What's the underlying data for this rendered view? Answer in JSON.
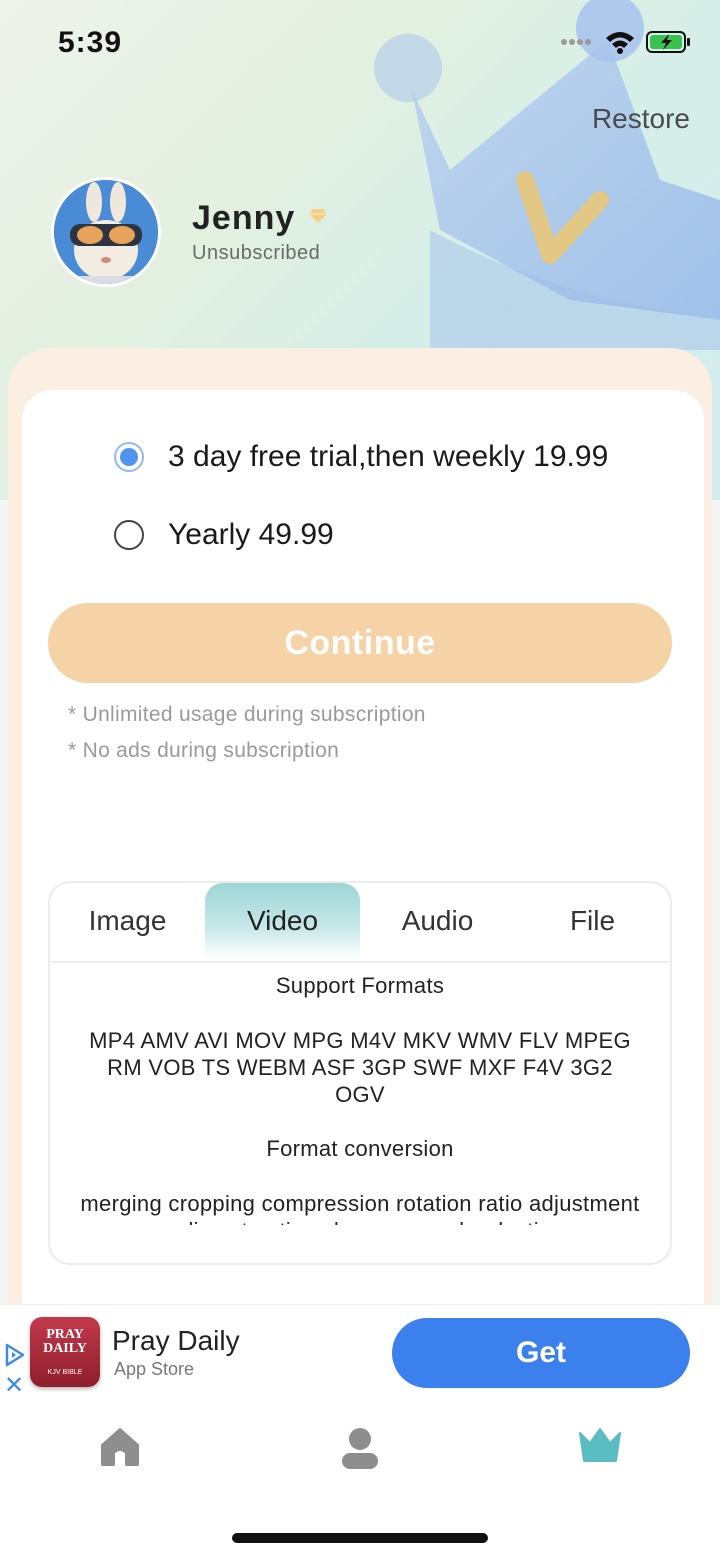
{
  "status_bar": {
    "time": "5:39"
  },
  "header": {
    "restore_label": "Restore"
  },
  "profile": {
    "name": "Jenny",
    "status": "Unsubscribed"
  },
  "plans": [
    {
      "label": "3 day free trial,then weekly 19.99",
      "selected": true
    },
    {
      "label": "Yearly 49.99",
      "selected": false
    }
  ],
  "continue_label": "Continue",
  "notes": [
    "* Unlimited usage during subscription",
    "* No ads during subscription"
  ],
  "formats": {
    "tabs": [
      "Image",
      "Video",
      "Audio",
      "File"
    ],
    "active_tab": "Video",
    "support_heading": "Support Formats",
    "support_list": "MP4 AMV AVI MOV MPG M4V MKV WMV FLV MPEG RM VOB TS WEBM ASF 3GP SWF MXF F4V 3G2 OGV",
    "conversion_heading": "Format conversion",
    "conversion_list": "merging cropping compression rotation ratio adjustment audio extraction change speed reduction"
  },
  "ad": {
    "app_name": "Pray Daily",
    "store": "App Store",
    "cta": "Get",
    "icon_text_top": "PRAY DAILY",
    "icon_text_bottom": "KJV BIBLE"
  },
  "bottom_nav": {
    "items": [
      {
        "icon": "home-icon",
        "active": false
      },
      {
        "icon": "user-icon",
        "active": false
      },
      {
        "icon": "crown-icon",
        "active": true
      }
    ]
  },
  "colors": {
    "accent_blue": "#3c80ee",
    "continue_peach": "#f6d2a7",
    "active_tab_teal": "#9ed5d6",
    "crown_teal": "#5cbcc3"
  }
}
